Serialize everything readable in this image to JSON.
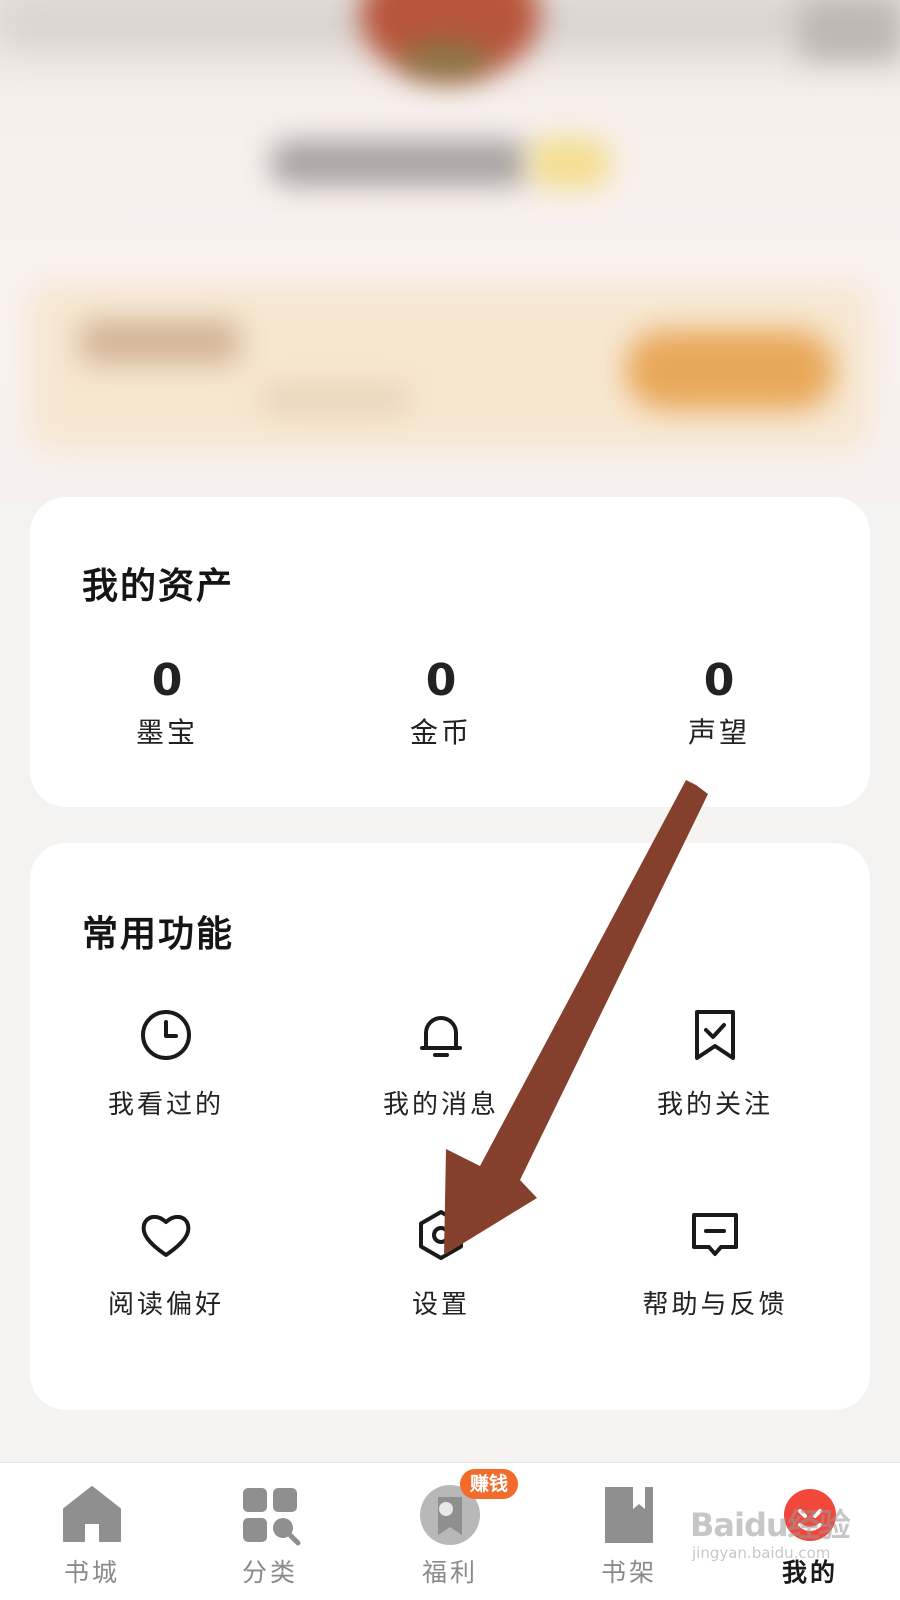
{
  "assets": {
    "title": "我的资产",
    "items": [
      {
        "value": "0",
        "label": "墨宝"
      },
      {
        "value": "0",
        "label": "金币"
      },
      {
        "value": "0",
        "label": "声望"
      }
    ]
  },
  "functions": {
    "title": "常用功能",
    "items": [
      {
        "label": "我看过的",
        "icon": "clock-icon"
      },
      {
        "label": "我的消息",
        "icon": "bell-icon"
      },
      {
        "label": "我的关注",
        "icon": "bookmark-check-icon"
      },
      {
        "label": "阅读偏好",
        "icon": "heart-icon"
      },
      {
        "label": "设置",
        "icon": "settings-hex-icon"
      },
      {
        "label": "帮助与反馈",
        "icon": "feedback-message-icon"
      }
    ]
  },
  "tabbar": {
    "tabs": [
      {
        "label": "书城",
        "icon": "home-icon",
        "active": false
      },
      {
        "label": "分类",
        "icon": "category-grid-icon",
        "active": false
      },
      {
        "label": "福利",
        "icon": "gift-icon",
        "active": false
      },
      {
        "label": "书架",
        "icon": "bookshelf-icon",
        "active": false
      },
      {
        "label": "我的",
        "icon": "profile-face-icon",
        "active": true
      }
    ],
    "earn_badge": "赚钱"
  },
  "watermark": {
    "logo": "Baidu经验",
    "url": "jingyan.baidu.com"
  },
  "colors": {
    "accent": "#f2473b",
    "badge": "#f26b2a",
    "annotation_arrow": "#84402c",
    "inactive_tab": "#8a8a8a"
  }
}
